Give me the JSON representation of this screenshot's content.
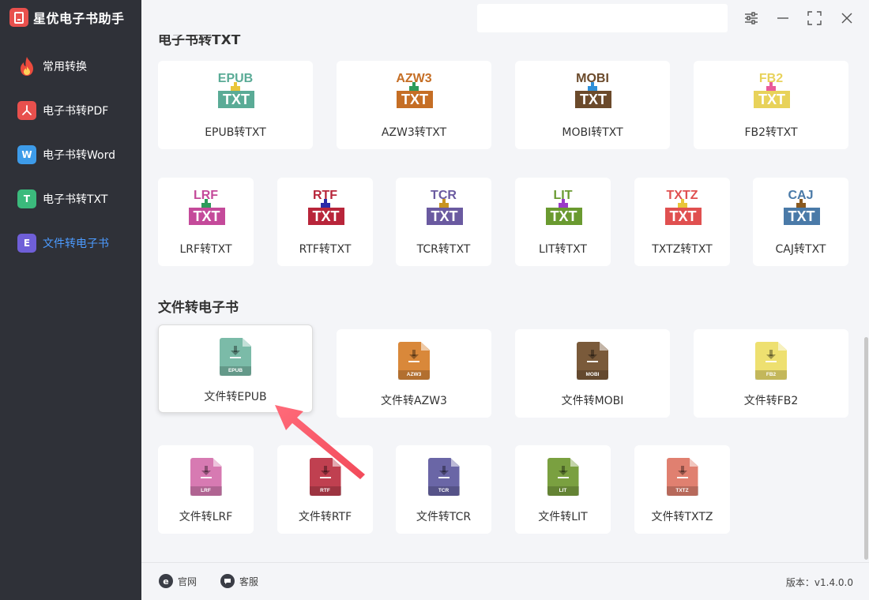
{
  "app": {
    "title": "星优电子书助手"
  },
  "sidebar": {
    "items": [
      {
        "label": "常用转换",
        "icon": "flame-icon",
        "color": "#e94b3c",
        "glyph": ""
      },
      {
        "label": "电子书转PDF",
        "icon": "pdf-icon",
        "color": "#e8504d",
        "glyph": "⅄"
      },
      {
        "label": "电子书转Word",
        "icon": "word-icon",
        "color": "#3d9be9",
        "glyph": "W"
      },
      {
        "label": "电子书转TXT",
        "icon": "txt-icon",
        "color": "#3bba7c",
        "glyph": "T"
      },
      {
        "label": "文件转电子书",
        "icon": "ebook-icon",
        "color": "#6f5fd8",
        "glyph": "E",
        "active": true
      }
    ]
  },
  "window_controls": {
    "settings": "settings-icon",
    "minimize": "minimize-icon",
    "maximize": "maximize-icon",
    "close": "close-icon"
  },
  "sections": {
    "to_txt_title": "电子书转TXT",
    "to_ebook_title": "文件转电子书"
  },
  "to_txt_cards": [
    {
      "format": "EPUB",
      "label": "EPUB转TXT",
      "color": "#5aab96",
      "arrow": "#e9c53a"
    },
    {
      "format": "AZW3",
      "label": "AZW3转TXT",
      "color": "#c56e25",
      "arrow": "#2d9b5a"
    },
    {
      "format": "MOBI",
      "label": "MOBI转TXT",
      "color": "#6b4a2b",
      "arrow": "#2e8fd8"
    },
    {
      "format": "FB2",
      "label": "FB2转TXT",
      "color": "#e8d25a",
      "arrow": "#e95a9a"
    },
    {
      "format": "LRF",
      "label": "LRF转TXT",
      "color": "#c44a9a",
      "arrow": "#2d9b5a"
    },
    {
      "format": "RTF",
      "label": "RTF转TXT",
      "color": "#b8253a",
      "arrow": "#2a2aa8"
    },
    {
      "format": "TCR",
      "label": "TCR转TXT",
      "color": "#6a5aa0",
      "arrow": "#c89420"
    },
    {
      "format": "LIT",
      "label": "LIT转TXT",
      "color": "#6a9a30",
      "arrow": "#9a3ac8"
    },
    {
      "format": "TXTZ",
      "label": "TXTZ转TXT",
      "color": "#e05050",
      "arrow": "#e9c53a"
    },
    {
      "format": "CAJ",
      "label": "CAJ转TXT",
      "color": "#4a7aa8",
      "arrow": "#8a5a20"
    }
  ],
  "to_ebook_cards": [
    {
      "format": "EPUB",
      "label": "文件转EPUB",
      "color": "#7bbba8",
      "selected": true
    },
    {
      "format": "AZW3",
      "label": "文件转AZW3",
      "color": "#d9883a"
    },
    {
      "format": "MOBI",
      "label": "文件转MOBI",
      "color": "#7a5a3a"
    },
    {
      "format": "FB2",
      "label": "文件转FB2",
      "color": "#eee070"
    },
    {
      "format": "LRF",
      "label": "文件转LRF",
      "color": "#d77ab2"
    },
    {
      "format": "RTF",
      "label": "文件转RTF",
      "color": "#c04050"
    },
    {
      "format": "TCR",
      "label": "文件转TCR",
      "color": "#6a66a6"
    },
    {
      "format": "LIT",
      "label": "文件转LIT",
      "color": "#7aa040"
    },
    {
      "format": "TXTZ",
      "label": "文件转TXTZ",
      "color": "#e08070"
    }
  ],
  "footer": {
    "website": "官网",
    "support": "客服",
    "version": "版本：v1.4.0.0"
  },
  "accent": "#4c9bff"
}
